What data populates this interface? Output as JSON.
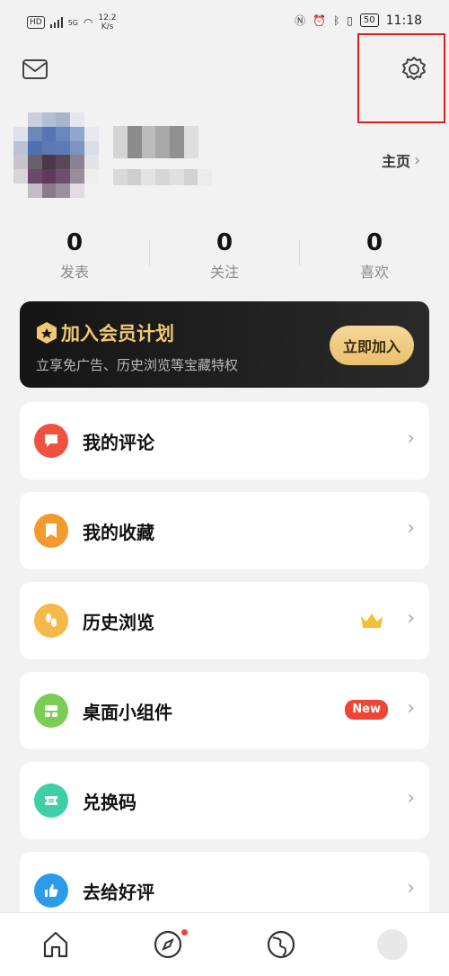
{
  "status_bar": {
    "hd_badge": "HD",
    "signal_tag": "5G",
    "speed_value": "12.2",
    "speed_unit": "K/s",
    "battery": "50",
    "time": "11:18"
  },
  "header": {
    "mail_icon": "mail-icon",
    "settings_icon": "gear-icon"
  },
  "profile": {
    "homepage_label": "主页"
  },
  "stats": [
    {
      "value": "0",
      "label": "发表"
    },
    {
      "value": "0",
      "label": "关注"
    },
    {
      "value": "0",
      "label": "喜欢"
    }
  ],
  "vip": {
    "title": "加入会员计划",
    "subtitle": "立享免广告、历史浏览等宝藏特权",
    "button": "立即加入",
    "accent": "#f0c772"
  },
  "menu": [
    {
      "label": "我的评论",
      "icon": "comment-icon",
      "color": "#f0523f"
    },
    {
      "label": "我的收藏",
      "icon": "bookmark-icon",
      "color": "#f39a2c"
    },
    {
      "label": "历史浏览",
      "icon": "footprint-icon",
      "color": "#f5b94a",
      "extra": "crown-icon"
    },
    {
      "label": "桌面小组件",
      "icon": "widget-icon",
      "color": "#7ccd54",
      "badge": "New"
    },
    {
      "label": "兑换码",
      "icon": "ticket-icon",
      "color": "#3fcfa7"
    },
    {
      "label": "去给好评",
      "icon": "thumbs-up-icon",
      "color": "#2e9be8"
    }
  ],
  "bottom_nav": [
    {
      "icon": "home-icon"
    },
    {
      "icon": "compass-icon"
    },
    {
      "icon": "globe-icon"
    },
    {
      "icon": "profile-icon"
    }
  ]
}
